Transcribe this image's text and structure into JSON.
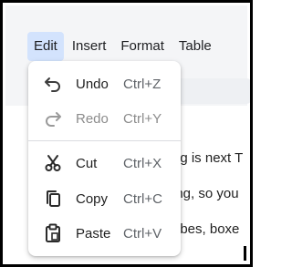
{
  "menubar": {
    "items": [
      {
        "label": "Edit",
        "active": true
      },
      {
        "label": "Insert"
      },
      {
        "label": "Format"
      },
      {
        "label": "Table"
      }
    ]
  },
  "document": {
    "lines": [
      "ng is next T",
      "ing, so you",
      "ubes, boxe"
    ]
  },
  "edit_menu": {
    "items": [
      {
        "label": "Undo",
        "shortcut": "Ctrl+Z",
        "icon": "undo-icon",
        "enabled": true
      },
      {
        "label": "Redo",
        "shortcut": "Ctrl+Y",
        "icon": "redo-icon",
        "enabled": false
      },
      {
        "label": "Cut",
        "shortcut": "Ctrl+X",
        "icon": "scissors-icon",
        "enabled": true
      },
      {
        "label": "Copy",
        "shortcut": "Ctrl+C",
        "icon": "copy-icon",
        "enabled": true
      },
      {
        "label": "Paste",
        "shortcut": "Ctrl+V",
        "icon": "paste-icon",
        "enabled": true
      }
    ]
  },
  "colors": {
    "active_menu_bg": "#d3e3fd",
    "menubar_bg": "#f4f5f7",
    "disabled_text": "#8c8c8c"
  }
}
